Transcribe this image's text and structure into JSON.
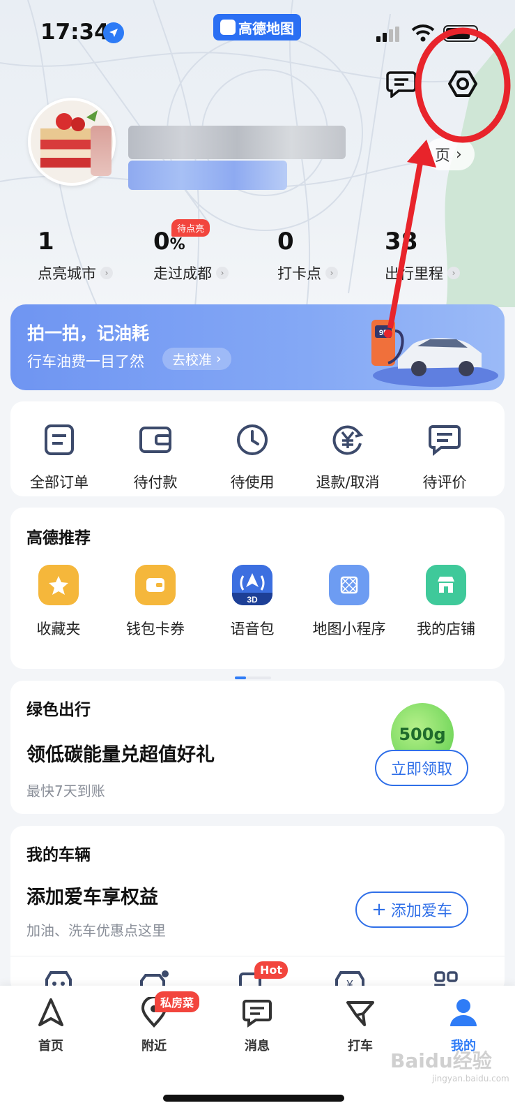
{
  "status_bar": {
    "time": "17:34"
  },
  "app_badge": {
    "label": "高德地图"
  },
  "header": {
    "message_icon": "message-square-icon",
    "settings_icon": "hexagon-settings-icon",
    "profile_link_label": "页"
  },
  "stats": [
    {
      "value": "1",
      "label": "点亮城市"
    },
    {
      "value": "0",
      "unit": "%",
      "label": "走过成都",
      "badge": "待点亮"
    },
    {
      "value": "0",
      "label": "打卡点"
    },
    {
      "value": "38",
      "label": "出行里程"
    }
  ],
  "fuel_banner": {
    "title": "拍一拍，记油耗",
    "subtitle": "行车油费一目了然",
    "button": "去校准",
    "pump_label": "95"
  },
  "orders": [
    {
      "label": "全部订单",
      "icon": "order-list-icon"
    },
    {
      "label": "待付款",
      "icon": "wallet-icon"
    },
    {
      "label": "待使用",
      "icon": "clock-icon"
    },
    {
      "label": "退款/取消",
      "icon": "yuan-refund-icon"
    },
    {
      "label": "待评价",
      "icon": "comment-icon"
    }
  ],
  "recommend": {
    "title": "高德推荐",
    "items": [
      {
        "label": "收藏夹",
        "icon": "star-icon",
        "color": "#f5b73b"
      },
      {
        "label": "钱包卡券",
        "icon": "wallet-icon",
        "color": "#f5b73b"
      },
      {
        "label": "语音包",
        "icon": "voice-3d-icon",
        "color": "#3c6fe0",
        "tag": "3D"
      },
      {
        "label": "地图小程序",
        "icon": "mini-program-icon",
        "color": "#6d9cf2"
      },
      {
        "label": "我的店铺",
        "icon": "shop-icon",
        "color": "#3fc99a"
      }
    ]
  },
  "green": {
    "title": "绿色出行",
    "headline": "领低碳能量兑超值好礼",
    "sub": "最快7天到账",
    "energy": "500g",
    "button": "立即领取"
  },
  "vehicle": {
    "title": "我的车辆",
    "headline": "添加爱车享权益",
    "sub": "加油、洗车优惠点这里",
    "button": "添加爱车",
    "hot_badge": "Hot"
  },
  "nav": [
    {
      "label": "首页",
      "icon": "navigate-arrow-icon"
    },
    {
      "label": "附近",
      "icon": "location-pin-icon",
      "badge": "私房菜"
    },
    {
      "label": "消息",
      "icon": "message-icon"
    },
    {
      "label": "打车",
      "icon": "taxi-flag-icon"
    },
    {
      "label": "我的",
      "icon": "user-icon",
      "active": true
    }
  ],
  "colors": {
    "accent": "#2f7cf6",
    "annotation": "#e8242b",
    "banner": "#7a9ef4"
  },
  "watermark": {
    "text": "Baidu经验",
    "sub": "jingyan.baidu.com"
  }
}
